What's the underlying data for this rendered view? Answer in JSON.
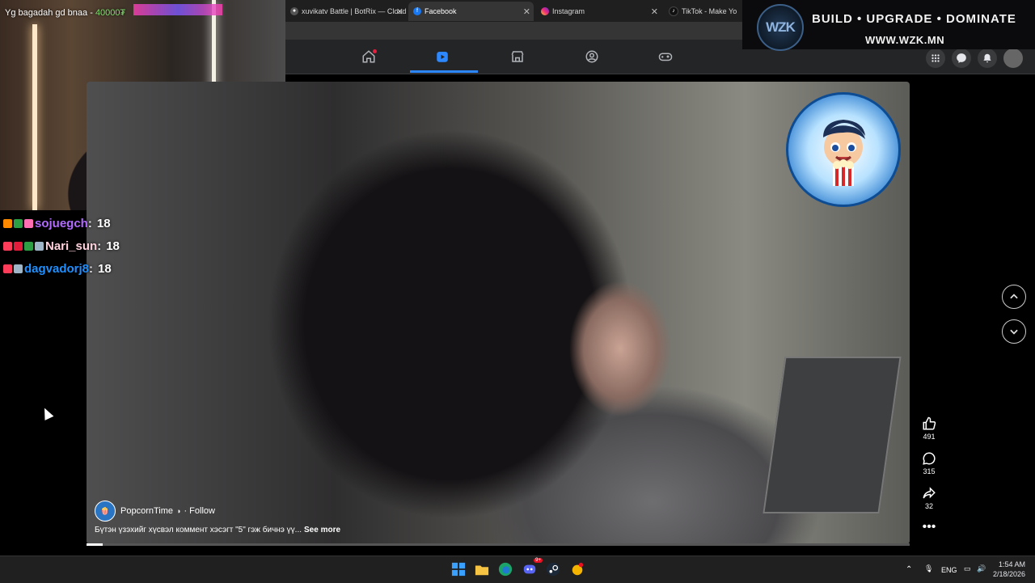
{
  "browser": {
    "tabs": [
      {
        "label": "xuvikatv Battle | BotRix — Cloud S",
        "icon": "botrix-icon"
      },
      {
        "label": "Facebook",
        "icon": "facebook-icon",
        "active": true
      },
      {
        "label": "Instagram",
        "icon": "instagram-icon"
      },
      {
        "label": "TikTok - Make Yo",
        "icon": "tiktok-icon"
      }
    ]
  },
  "fb_nav": {
    "items": [
      "home-icon",
      "reels-icon",
      "marketplace-icon",
      "groups-icon",
      "gaming-icon"
    ],
    "active": "reels-icon",
    "right": [
      "menu-grid-icon",
      "messenger-icon",
      "bell-icon",
      "profile-avatar"
    ]
  },
  "banner": {
    "logo": "WZK",
    "tagline": "BUILD • UPGRADE • DOMINATE",
    "url": "WWW.WZK.MN"
  },
  "webcam": {
    "label_prefix": "Yg bagadah gd bnaa - ",
    "label_amount": "40000₮"
  },
  "chat": [
    {
      "user": "sojuegch",
      "message": "18",
      "color": "#b36bff"
    },
    {
      "user": "Nari_sun",
      "message": "18",
      "color": "#ffd1dc"
    },
    {
      "user": "dagvadorj8",
      "message": "18",
      "color": "#1e90ff"
    }
  ],
  "reel": {
    "author": "PopcornTime",
    "follow": "· Follow",
    "caption": "Бүтэн үзэхийг хүсвэл коммент хэсэгт \"5\" гэж бичнэ үү...",
    "see_more": "See more",
    "likes": "491",
    "comments": "315",
    "shares": "32",
    "progress": 0.02
  },
  "taskbar": {
    "language": "ENG",
    "time": "1:54 AM",
    "date": "2/18/2026",
    "discord_badge": "9+"
  }
}
